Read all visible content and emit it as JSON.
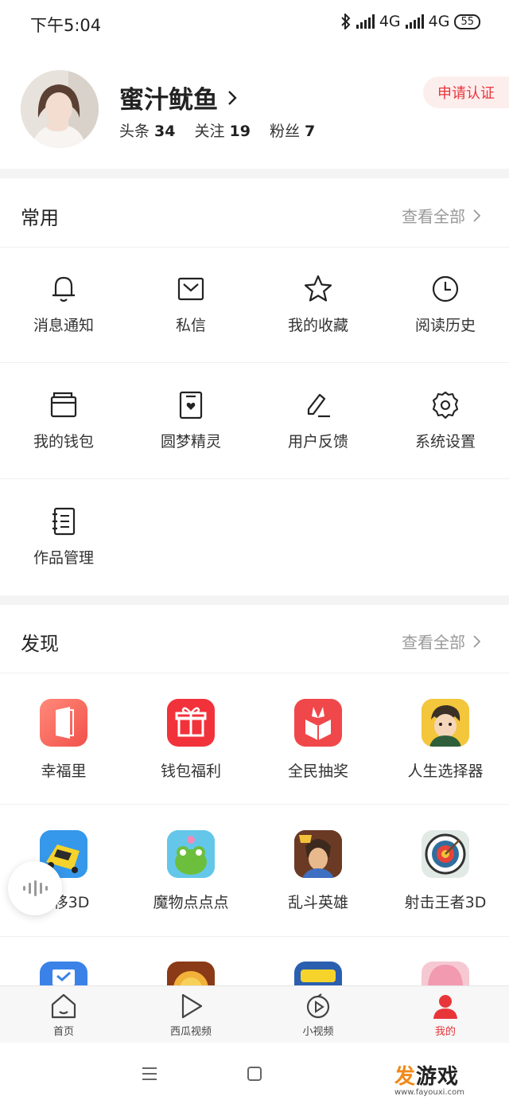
{
  "status_bar": {
    "time": "下午5:04",
    "net1": "4G",
    "net2": "4G",
    "battery": "55"
  },
  "profile": {
    "username": "蜜汁鱿鱼",
    "apply_label": "申请认证",
    "stats": [
      {
        "label": "头条",
        "value": "34"
      },
      {
        "label": "关注",
        "value": "19"
      },
      {
        "label": "粉丝",
        "value": "7"
      }
    ]
  },
  "common": {
    "title": "常用",
    "see_all": "查看全部",
    "items": [
      {
        "label": "消息通知",
        "icon": "bell-icon"
      },
      {
        "label": "私信",
        "icon": "envelope-icon"
      },
      {
        "label": "我的收藏",
        "icon": "star-icon"
      },
      {
        "label": "阅读历史",
        "icon": "clock-icon"
      },
      {
        "label": "我的钱包",
        "icon": "wallet-icon"
      },
      {
        "label": "圆梦精灵",
        "icon": "heart-box-icon"
      },
      {
        "label": "用户反馈",
        "icon": "pencil-icon"
      },
      {
        "label": "系统设置",
        "icon": "gear-icon"
      },
      {
        "label": "作品管理",
        "icon": "notebook-icon"
      }
    ]
  },
  "discover": {
    "title": "发现",
    "see_all": "查看全部",
    "items": [
      {
        "label": "幸福里",
        "icon": "door-app-icon"
      },
      {
        "label": "钱包福利",
        "icon": "gift-app-icon"
      },
      {
        "label": "全民抽奖",
        "icon": "lottery-box-app-icon"
      },
      {
        "label": "人生选择器",
        "icon": "cartoon-boy-app-icon"
      },
      {
        "label": "漂移3D",
        "icon": "car-app-icon"
      },
      {
        "label": "魔物点点点",
        "icon": "frog-app-icon"
      },
      {
        "label": "乱斗英雄",
        "icon": "hero-app-icon"
      },
      {
        "label": "射击王者3D",
        "icon": "target-app-icon"
      }
    ]
  },
  "tabbar": [
    {
      "label": "首页",
      "icon": "home-icon"
    },
    {
      "label": "西瓜视频",
      "icon": "play-icon"
    },
    {
      "label": "小视频",
      "icon": "short-video-icon"
    },
    {
      "label": "我的",
      "icon": "person-icon"
    }
  ],
  "watermark": {
    "main_a": "发",
    "main_b": "游戏",
    "url": "www.fayouxi.com"
  },
  "colors": {
    "accent": "#e8353a",
    "muted": "#999999"
  }
}
